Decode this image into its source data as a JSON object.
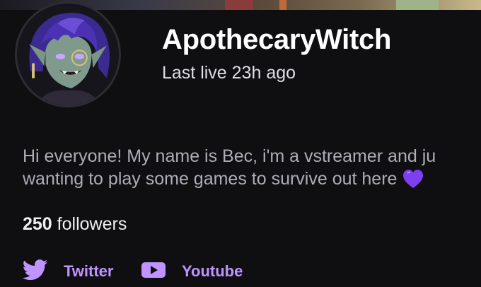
{
  "channel": {
    "name": "ApothecaryWitch",
    "last_live": "Last live 23h ago"
  },
  "bio": {
    "line1": "Hi everyone! My name is Bec, i'm a vstreamer and ju",
    "line2": "wanting to play some games to survive out here"
  },
  "followers": {
    "count": "250",
    "label": "followers"
  },
  "social_links": [
    {
      "label": "Twitter",
      "icon": "twitter-bird-icon"
    },
    {
      "label": "Youtube",
      "icon": "youtube-play-icon"
    }
  ],
  "colors": {
    "background": "#0f0e11",
    "accent_purple": "#bf94ff",
    "heart_purple": "#9146ff",
    "bio_text": "#adadb8"
  }
}
